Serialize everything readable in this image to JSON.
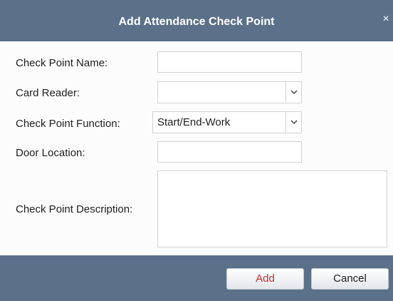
{
  "dialog": {
    "title": "Add Attendance Check Point",
    "close_glyph": "×"
  },
  "form": {
    "check_point_name": {
      "label": "Check Point Name:",
      "value": ""
    },
    "card_reader": {
      "label": "Card Reader:",
      "value": ""
    },
    "check_point_function": {
      "label": "Check Point Function:",
      "value": "Start/End-Work"
    },
    "door_location": {
      "label": "Door Location:",
      "value": ""
    },
    "check_point_description": {
      "label": "Check Point Description:",
      "value": ""
    }
  },
  "buttons": {
    "add": "Add",
    "cancel": "Cancel"
  },
  "colors": {
    "titlebar": "#5b7089",
    "add_text": "#d12b2b"
  },
  "icons": {
    "dropdown": "chevron-down-icon",
    "close": "close-icon"
  }
}
